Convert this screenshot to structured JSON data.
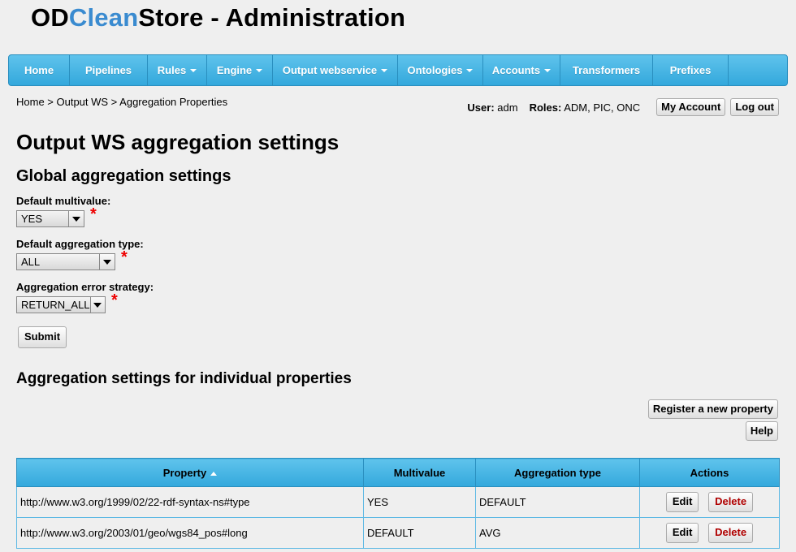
{
  "app": {
    "title_prefix": "OD",
    "title_highlight": "Clean",
    "title_suffix": "Store - Administration",
    "highlight_color": "#3a8bd0"
  },
  "nav": [
    {
      "label": "Home",
      "dropdown": false
    },
    {
      "label": "Pipelines",
      "dropdown": false
    },
    {
      "label": "Rules",
      "dropdown": true
    },
    {
      "label": "Engine",
      "dropdown": true
    },
    {
      "label": "Output webservice",
      "dropdown": true
    },
    {
      "label": "Ontologies",
      "dropdown": true
    },
    {
      "label": "Accounts",
      "dropdown": true
    },
    {
      "label": "Transformers",
      "dropdown": false
    },
    {
      "label": "Prefixes",
      "dropdown": false
    }
  ],
  "breadcrumb": "Home > Output WS > Aggregation Properties",
  "user": {
    "user_label": "User:",
    "user_value": "adm",
    "roles_label": "Roles:",
    "roles_value": "ADM, PIC, ONC",
    "my_account": "My Account",
    "logout": "Log out"
  },
  "page_title": "Output WS aggregation settings",
  "global": {
    "heading": "Global aggregation settings",
    "multivalue_label": "Default multivalue:",
    "multivalue_value": "YES",
    "agg_type_label": "Default aggregation type:",
    "agg_type_value": "ALL",
    "error_strategy_label": "Aggregation error strategy:",
    "error_strategy_value": "RETURN_ALL",
    "required_mark": "*",
    "submit": "Submit"
  },
  "individual": {
    "heading": "Aggregation settings for individual properties",
    "register": "Register a new property",
    "help": "Help",
    "columns": [
      "Property",
      "Multivalue",
      "Aggregation type",
      "Actions"
    ],
    "rows": [
      {
        "property": "http://www.w3.org/1999/02/22-rdf-syntax-ns#type",
        "multivalue": "YES",
        "aggregation_type": "DEFAULT"
      },
      {
        "property": "http://www.w3.org/2003/01/geo/wgs84_pos#long",
        "multivalue": "DEFAULT",
        "aggregation_type": "AVG"
      }
    ],
    "edit": "Edit",
    "delete": "Delete"
  }
}
